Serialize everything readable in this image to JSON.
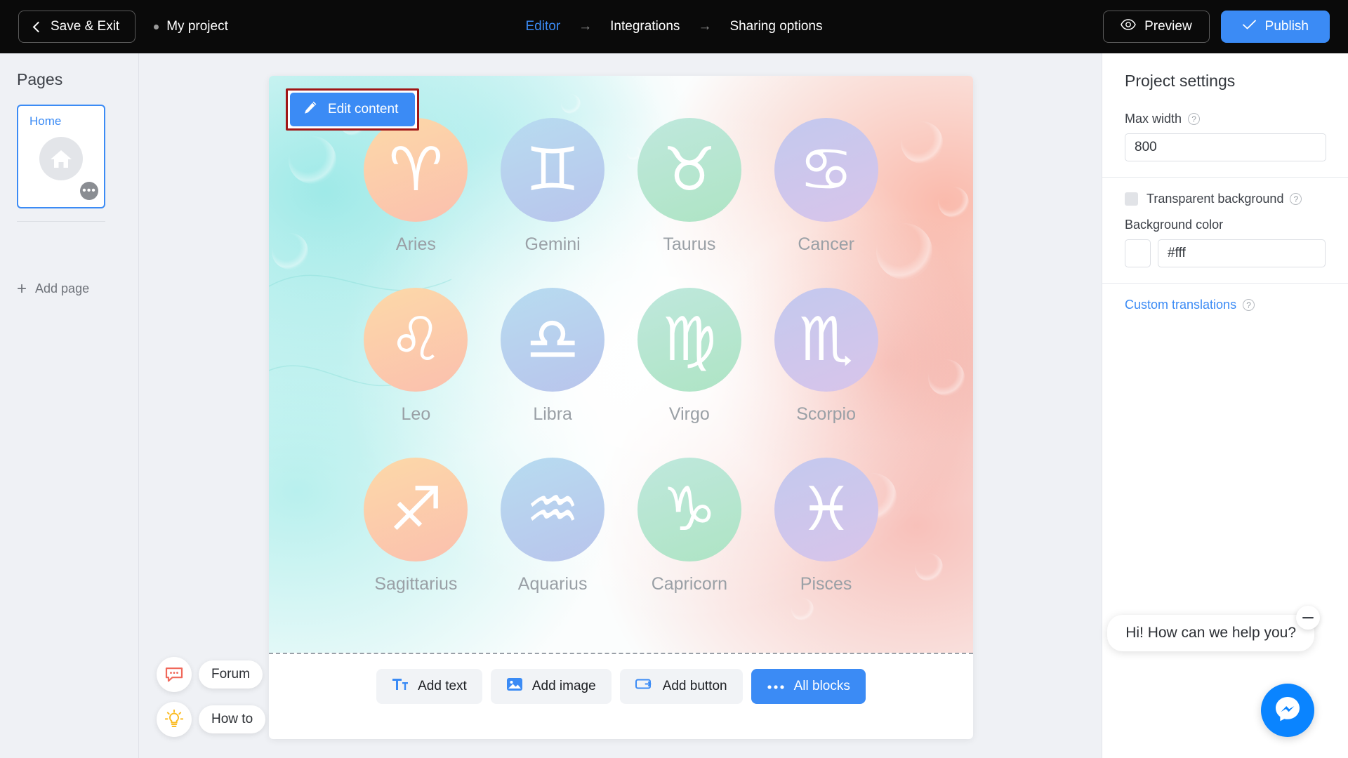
{
  "topbar": {
    "save_exit_label": "Save & Exit",
    "project_name": "My project",
    "nav": [
      {
        "label": "Editor",
        "active": true
      },
      {
        "label": "Integrations",
        "active": false
      },
      {
        "label": "Sharing options",
        "active": false
      }
    ],
    "nav_arrow": "→",
    "preview_label": "Preview",
    "publish_label": "Publish",
    "accent_color": "#3b8bf5",
    "background_color": "#0a0a0a"
  },
  "sidebar": {
    "title": "Pages",
    "page_card": {
      "label": "Home",
      "icon": "home-icon",
      "more_icon": "ellipsis-icon"
    },
    "add_page_label": "Add page"
  },
  "canvas": {
    "edit_content_label": "Edit content",
    "edit_content_icon": "pencil-icon",
    "highlight_color": "#a01616",
    "zodiac": [
      {
        "label": "Aries",
        "glyph": "♈",
        "c1": "#fcd9a8",
        "c2": "#fbbfae"
      },
      {
        "label": "Gemini",
        "glyph": "♊",
        "c1": "#b7dcf0",
        "c2": "#b9c4ec"
      },
      {
        "label": "Taurus",
        "glyph": "♉",
        "c1": "#bfe8dd",
        "c2": "#aee4c4"
      },
      {
        "label": "Cancer",
        "glyph": "♋",
        "c1": "#c3c9ee",
        "c2": "#d8c4ea"
      },
      {
        "label": "Leo",
        "glyph": "♌",
        "c1": "#fcd9a8",
        "c2": "#fbbfae"
      },
      {
        "label": "Libra",
        "glyph": "♎",
        "c1": "#b7dcf0",
        "c2": "#b9c4ec"
      },
      {
        "label": "Virgo",
        "glyph": "♍",
        "c1": "#bfe8dd",
        "c2": "#aee4c4"
      },
      {
        "label": "Scorpio",
        "glyph": "♏",
        "c1": "#c3c9ee",
        "c2": "#d8c4ea"
      },
      {
        "label": "Sagittarius",
        "glyph": "♐",
        "c1": "#fcd9a8",
        "c2": "#fbbfae"
      },
      {
        "label": "Aquarius",
        "glyph": "♒",
        "c1": "#b7dcf0",
        "c2": "#b9c4ec"
      },
      {
        "label": "Capricorn",
        "glyph": "♑",
        "c1": "#bfe8dd",
        "c2": "#aee4c4"
      },
      {
        "label": "Pisces",
        "glyph": "♓",
        "c1": "#c3c9ee",
        "c2": "#d8c4ea"
      }
    ],
    "toolbar": [
      {
        "label": "Add text",
        "icon": "text-icon",
        "primary": false
      },
      {
        "label": "Add image",
        "icon": "image-icon",
        "primary": false
      },
      {
        "label": "Add button",
        "icon": "button-icon",
        "primary": false
      },
      {
        "label": "All blocks",
        "icon": "ellipsis-icon",
        "primary": true
      }
    ],
    "help": [
      {
        "label": "Forum",
        "icon": "chat-bubble-icon",
        "color": "#f0685a"
      },
      {
        "label": "How to",
        "icon": "lightbulb-icon",
        "color": "#fbbc24"
      }
    ]
  },
  "right_panel": {
    "title": "Project settings",
    "max_width": {
      "label": "Max width",
      "value": "800",
      "help_icon": "question-icon"
    },
    "transparent_background": {
      "label": "Transparent background",
      "checked": false,
      "help_icon": "question-icon"
    },
    "background_color": {
      "label": "Background color",
      "value": "#fff",
      "swatch": "#ffffff"
    },
    "custom_translations": {
      "label": "Custom translations",
      "help_icon": "question-icon"
    }
  },
  "chat_widget": {
    "greeting": "Hi! How can we help you?",
    "minimize_icon": "minus-icon",
    "fab_icon": "messenger-icon",
    "fab_color": "#0a84ff"
  }
}
